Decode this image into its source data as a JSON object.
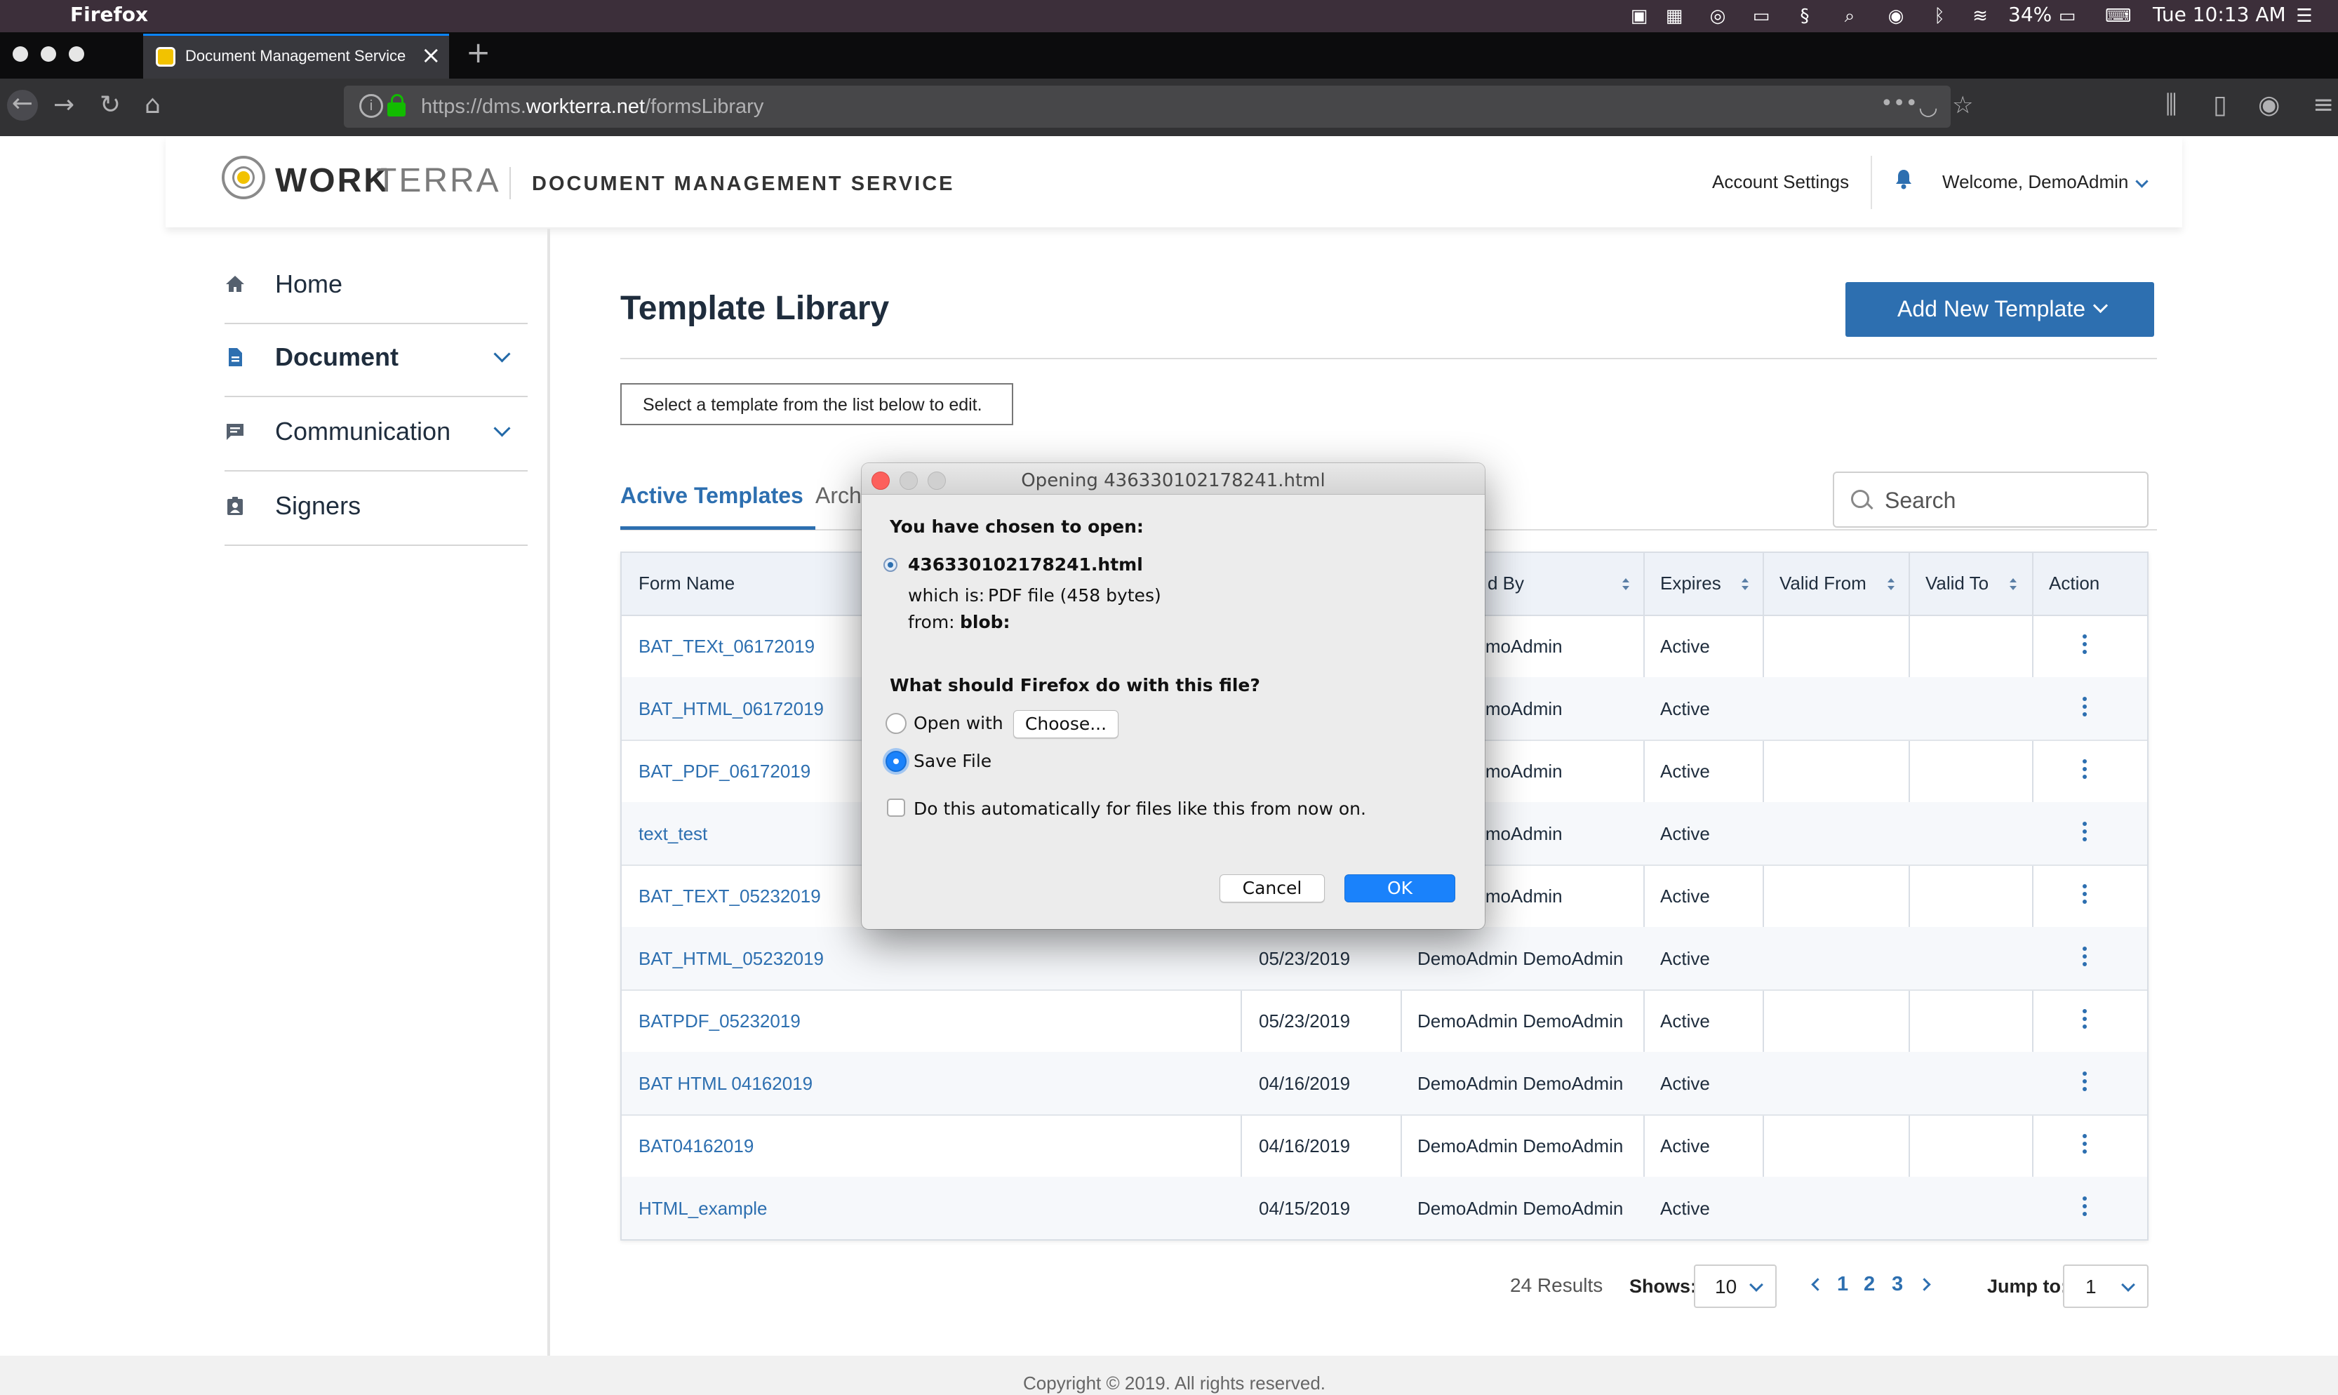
{
  "os": {
    "app_name": "Firefox",
    "battery": "34%",
    "clock": "Tue 10:13 AM"
  },
  "browser": {
    "tab_title": "Document Management Service",
    "url_prefix": "https://dms.",
    "url_domain": "workterra.net",
    "url_path": "/formsLibrary"
  },
  "header": {
    "logo_work": "WORK",
    "logo_terra": "TERRA",
    "service": "DOCUMENT MANAGEMENT SERVICE",
    "account_settings": "Account Settings",
    "welcome": "Welcome, DemoAdmin"
  },
  "sidebar": {
    "items": [
      {
        "label": "Home",
        "icon": "home-icon"
      },
      {
        "label": "Document",
        "icon": "document-icon"
      },
      {
        "label": "Communication",
        "icon": "chat-icon"
      },
      {
        "label": "Signers",
        "icon": "badge-icon"
      }
    ]
  },
  "main": {
    "title": "Template Library",
    "add_button": "Add New Template",
    "hint": "Select a template from the list below to edit.",
    "tab_active": "Active Templates",
    "tab_archived": "Arch",
    "search_placeholder": "Search"
  },
  "table": {
    "headers": {
      "form_name": "Form Name",
      "modified_by": "d By",
      "expires": "Expires",
      "valid_from": "Valid From",
      "valid_to": "Valid To",
      "action": "Action"
    },
    "rows": [
      {
        "name": "BAT_TEXt_06172019",
        "date": "",
        "by": "dmin DemoAdmin",
        "status": "Active"
      },
      {
        "name": "BAT_HTML_06172019",
        "date": "",
        "by": "dmin DemoAdmin",
        "status": "Active"
      },
      {
        "name": "BAT_PDF_06172019",
        "date": "",
        "by": "dmin DemoAdmin",
        "status": "Active"
      },
      {
        "name": "text_test",
        "date": "",
        "by": "dmin DemoAdmin",
        "status": "Active"
      },
      {
        "name": "BAT_TEXT_05232019",
        "date": "",
        "by": "dmin DemoAdmin",
        "status": "Active"
      },
      {
        "name": "BAT_HTML_05232019",
        "date": "05/23/2019",
        "by": "DemoAdmin DemoAdmin",
        "status": "Active"
      },
      {
        "name": "BATPDF_05232019",
        "date": "05/23/2019",
        "by": "DemoAdmin DemoAdmin",
        "status": "Active"
      },
      {
        "name": "BAT HTML 04162019",
        "date": "04/16/2019",
        "by": "DemoAdmin DemoAdmin",
        "status": "Active"
      },
      {
        "name": "BAT04162019",
        "date": "04/16/2019",
        "by": "DemoAdmin DemoAdmin",
        "status": "Active"
      },
      {
        "name": "HTML_example",
        "date": "04/15/2019",
        "by": "DemoAdmin DemoAdmin",
        "status": "Active"
      }
    ]
  },
  "pagination": {
    "results": "24 Results",
    "shows_label": "Shows:",
    "shows_value": "10",
    "pages": [
      "1",
      "2",
      "3"
    ],
    "jump_label": "Jump to:",
    "jump_value": "1"
  },
  "footer": {
    "copyright": "Copyright © 2019. All rights reserved."
  },
  "dialog": {
    "title": "Opening 436330102178241.html",
    "chosen": "You have chosen to open:",
    "filename": "436330102178241.html",
    "which_is_label": "which is:",
    "which_is_value": "PDF file (458 bytes)",
    "from_label": "from:",
    "from_value": "blob:",
    "question": "What should Firefox do with this file?",
    "open_with": "Open with",
    "choose": "Choose...",
    "save_file": "Save File",
    "auto": "Do this automatically for files like this from now on.",
    "cancel": "Cancel",
    "ok": "OK",
    "selected_option": "save_file"
  },
  "colors": {
    "accent": "#2d6fb0",
    "mac_blue": "#1a82fb",
    "menubar": "#3c2f3a"
  }
}
